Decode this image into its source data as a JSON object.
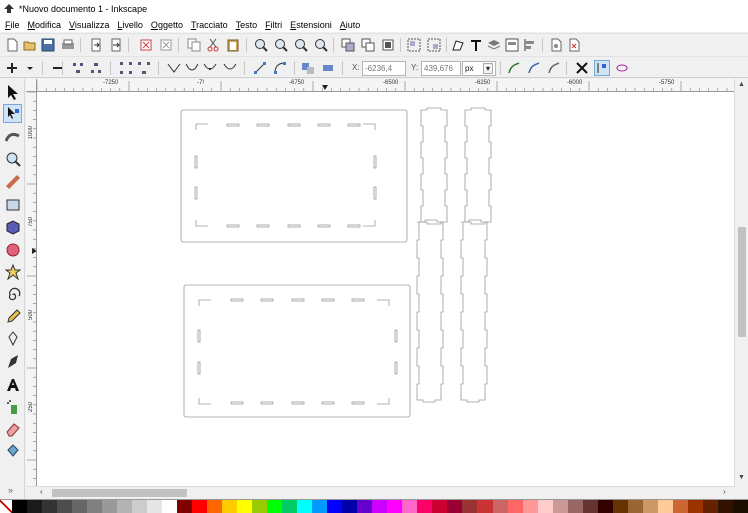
{
  "window": {
    "title": "*Nuovo documento 1 - Inkscape"
  },
  "menu": [
    {
      "accel": "F",
      "rest": "ile"
    },
    {
      "accel": "M",
      "rest": "odifica"
    },
    {
      "accel": "V",
      "rest": "isualizza"
    },
    {
      "accel": "L",
      "rest": "ivello"
    },
    {
      "accel": "O",
      "rest": "ggetto"
    },
    {
      "accel": "T",
      "rest": "racciato"
    },
    {
      "accel": "T",
      "rest": "esto"
    },
    {
      "accel": "F",
      "rest": "iltri"
    },
    {
      "accel": "E",
      "rest": "stensioni"
    },
    {
      "accel": "A",
      "rest": "iuto"
    }
  ],
  "controls": {
    "x_label": "X:",
    "x_value": "-6236,4",
    "y_label": "Y:",
    "y_value": "439,676",
    "unit": "px"
  },
  "ruler": {
    "h_labels": [
      "-7250",
      "-7!",
      "-6750",
      "-6500",
      "-6250",
      "-6000",
      "-5750"
    ],
    "v_labels": [
      "1000",
      "750",
      "500",
      "250"
    ]
  },
  "colors": {
    "accent": "#7aa7d6",
    "path_stroke": "#9a9a9a",
    "palette": [
      "#000000",
      "#1a1a1a",
      "#333333",
      "#4d4d4d",
      "#666666",
      "#808080",
      "#999999",
      "#b3b3b3",
      "#cccccc",
      "#e6e6e6",
      "#ffffff",
      "#800000",
      "#ff0000",
      "#ff6600",
      "#ffcc00",
      "#ffff00",
      "#99cc00",
      "#00ff00",
      "#00cc66",
      "#00ffff",
      "#0099ff",
      "#0000ff",
      "#0000aa",
      "#6600cc",
      "#cc00ff",
      "#ff00ff",
      "#ff66cc",
      "#ff0066",
      "#cc0033",
      "#990033",
      "#993333",
      "#cc3333",
      "#cc6666",
      "#ff6666",
      "#ff9999",
      "#ffcccc",
      "#cc9999",
      "#996666",
      "#663333",
      "#330000",
      "#663300",
      "#996633",
      "#cc9966",
      "#ffcc99",
      "#cc6633",
      "#993300",
      "#662200",
      "#331100",
      "#1a0d00"
    ]
  },
  "icons": {
    "toolbox": [
      "selector-icon",
      "node-icon",
      "tweak-icon",
      "zoom-icon",
      "measure-icon",
      "rect-icon",
      "3dbox-icon",
      "ellipse-icon",
      "star-icon",
      "spiral-icon",
      "pencil-icon",
      "pen-icon",
      "calligraphy-icon",
      "text-icon",
      "spray-icon",
      "eraser-icon",
      "bucket-icon"
    ]
  }
}
